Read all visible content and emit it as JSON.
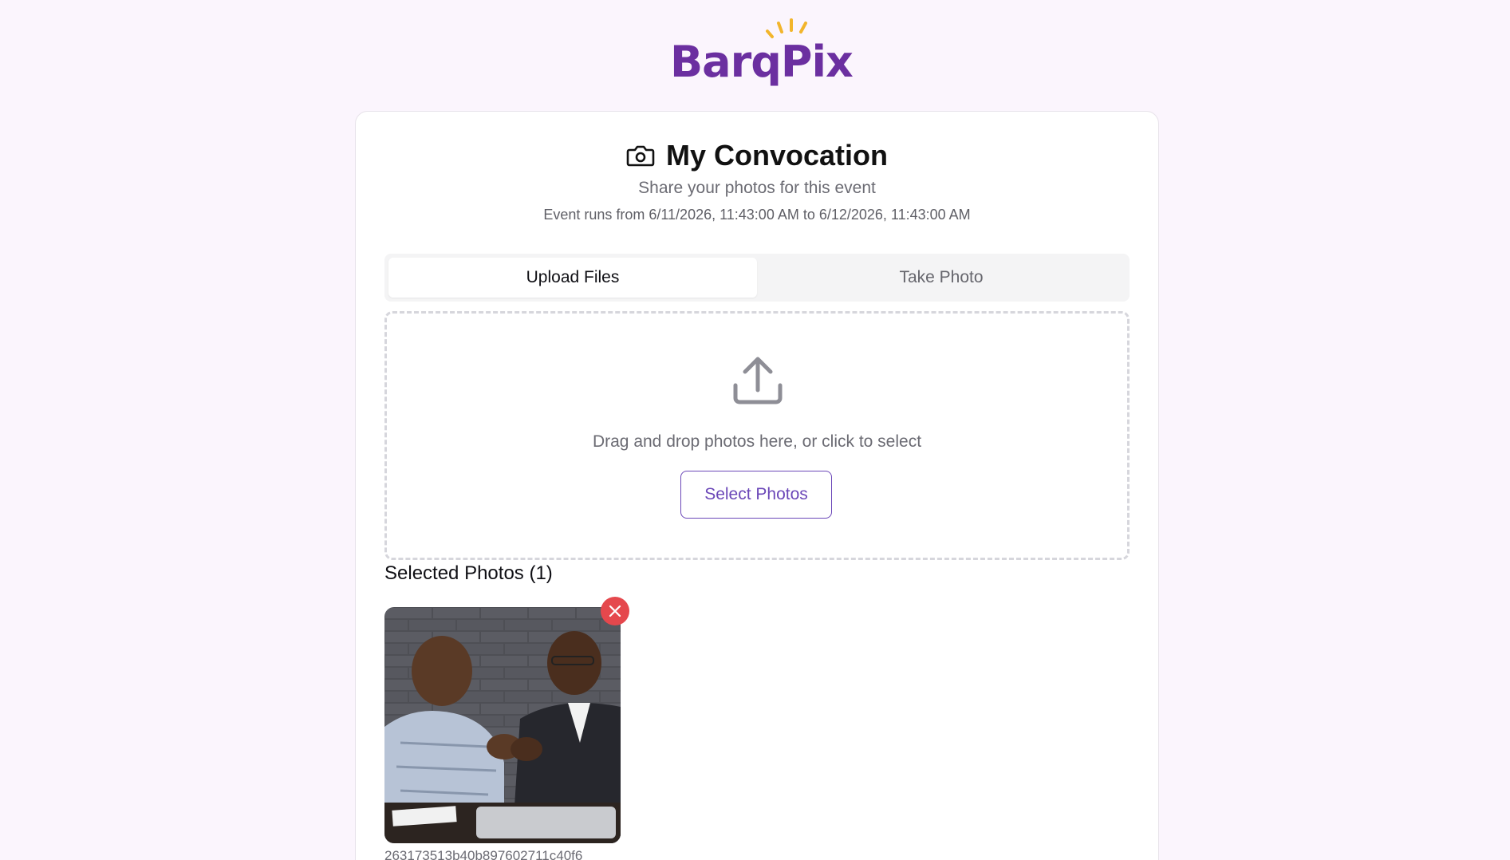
{
  "brand": {
    "name": "BarqPix",
    "ray_color": "#f2b52c",
    "text_color": "#6b2fa0"
  },
  "event": {
    "title": "My Convocation",
    "subtitle": "Share your photos for this event",
    "schedule": "Event runs from 6/11/2026, 11:43:00 AM to 6/12/2026, 11:43:00 AM"
  },
  "tabs": [
    {
      "label": "Upload Files",
      "active": true
    },
    {
      "label": "Take Photo",
      "active": false
    }
  ],
  "dropzone": {
    "icon": "upload-icon",
    "text": "Drag and drop photos here, or click to select",
    "button_label": "Select Photos"
  },
  "selected": {
    "heading": "Selected Photos (1)",
    "photos": [
      {
        "filename": "263173513b40b897602711c40f6"
      }
    ]
  },
  "colors": {
    "accent": "#6b47b8",
    "danger": "#e5484d",
    "background": "#fbf5fd"
  }
}
